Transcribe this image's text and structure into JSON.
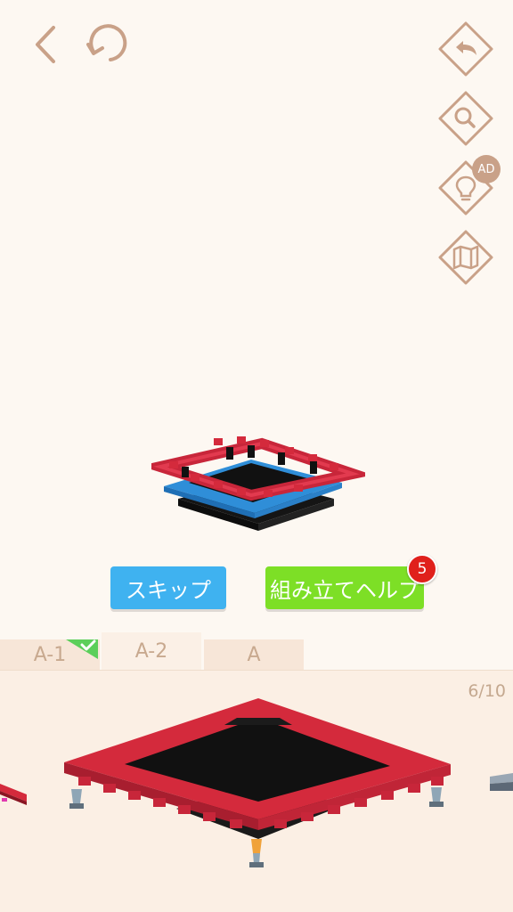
{
  "toolbar": {
    "back_icon": "chevron-left-icon",
    "reset_icon": "rotate-icon",
    "undo_icon": "undo-arrow-icon",
    "zoom_icon": "magnifier-icon",
    "hint_icon": "lightbulb-icon",
    "map_icon": "map-icon",
    "ad_badge": "AD"
  },
  "actions": {
    "skip_label": "スキップ",
    "help_label": "組み立てヘルプ",
    "help_count": "5"
  },
  "tabs": [
    {
      "label": "A-1",
      "completed": true
    },
    {
      "label": "A-2",
      "active": true
    },
    {
      "label": "A"
    }
  ],
  "tray": {
    "page_counter": "6/10"
  },
  "colors": {
    "background": "#fdf8f2",
    "accent_icon": "#c9a188",
    "skip_button": "#3fb2f0",
    "help_button": "#7ddf26",
    "badge_red": "#e0201b",
    "trampoline_red": "#d42a3c",
    "frame_blue": "#2f8ed8"
  }
}
